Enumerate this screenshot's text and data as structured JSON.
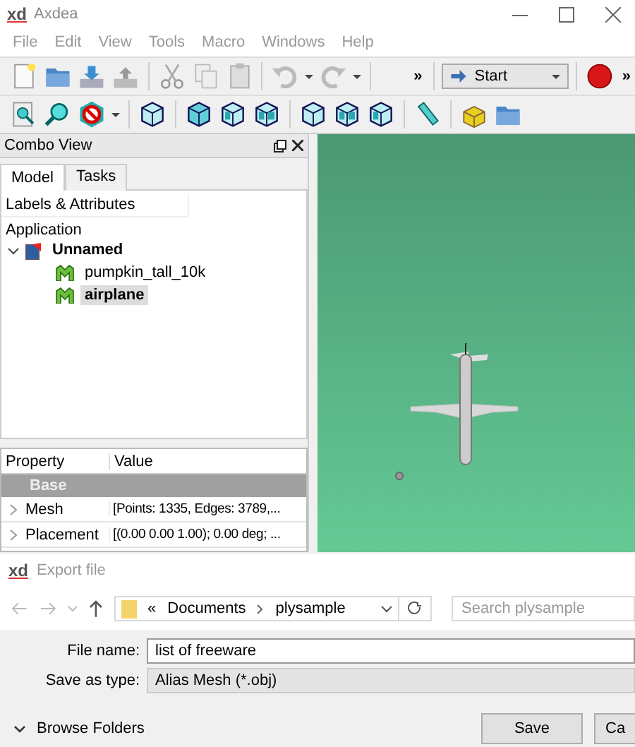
{
  "window": {
    "logo": "xd",
    "title": "Axdea"
  },
  "menu": [
    "File",
    "Edit",
    "View",
    "Tools",
    "Macro",
    "Windows",
    "Help"
  ],
  "toolbar": {
    "overflow": [
      "»",
      "»"
    ],
    "workbench": "Start"
  },
  "combo_view": {
    "title": "Combo View",
    "tabs": [
      {
        "label": "Model",
        "selected": true
      },
      {
        "label": "Tasks",
        "selected": false
      }
    ],
    "tree_header": "Labels & Attributes",
    "root": "Application",
    "tree": [
      {
        "label": "Unnamed",
        "kind": "document",
        "expanded": true,
        "selected": false,
        "children": [
          {
            "label": "pumpkin_tall_10k",
            "kind": "mesh",
            "selected": false
          },
          {
            "label": "airplane",
            "kind": "mesh",
            "selected": true
          }
        ]
      }
    ],
    "properties": {
      "columns": [
        "Property",
        "Value"
      ],
      "group": "Base",
      "rows": [
        {
          "name": "Mesh",
          "value": "[Points: 1335, Edges: 3789,..."
        },
        {
          "name": "Placement",
          "value": "[(0.00 0.00 1.00); 0.00 deg; ..."
        }
      ]
    }
  },
  "dialog": {
    "logo": "xd",
    "title": "Export file",
    "path_prefix": "«",
    "path": [
      "Documents",
      "plysample"
    ],
    "search": {
      "placeholder": "Search plysample"
    },
    "file_name": {
      "label": "File name:",
      "value": "list of freeware"
    },
    "save_type": {
      "label": "Save as type:",
      "value": "Alias Mesh (*.obj)"
    },
    "browse": "Browse Folders",
    "buttons": [
      "Save",
      "Ca"
    ]
  }
}
